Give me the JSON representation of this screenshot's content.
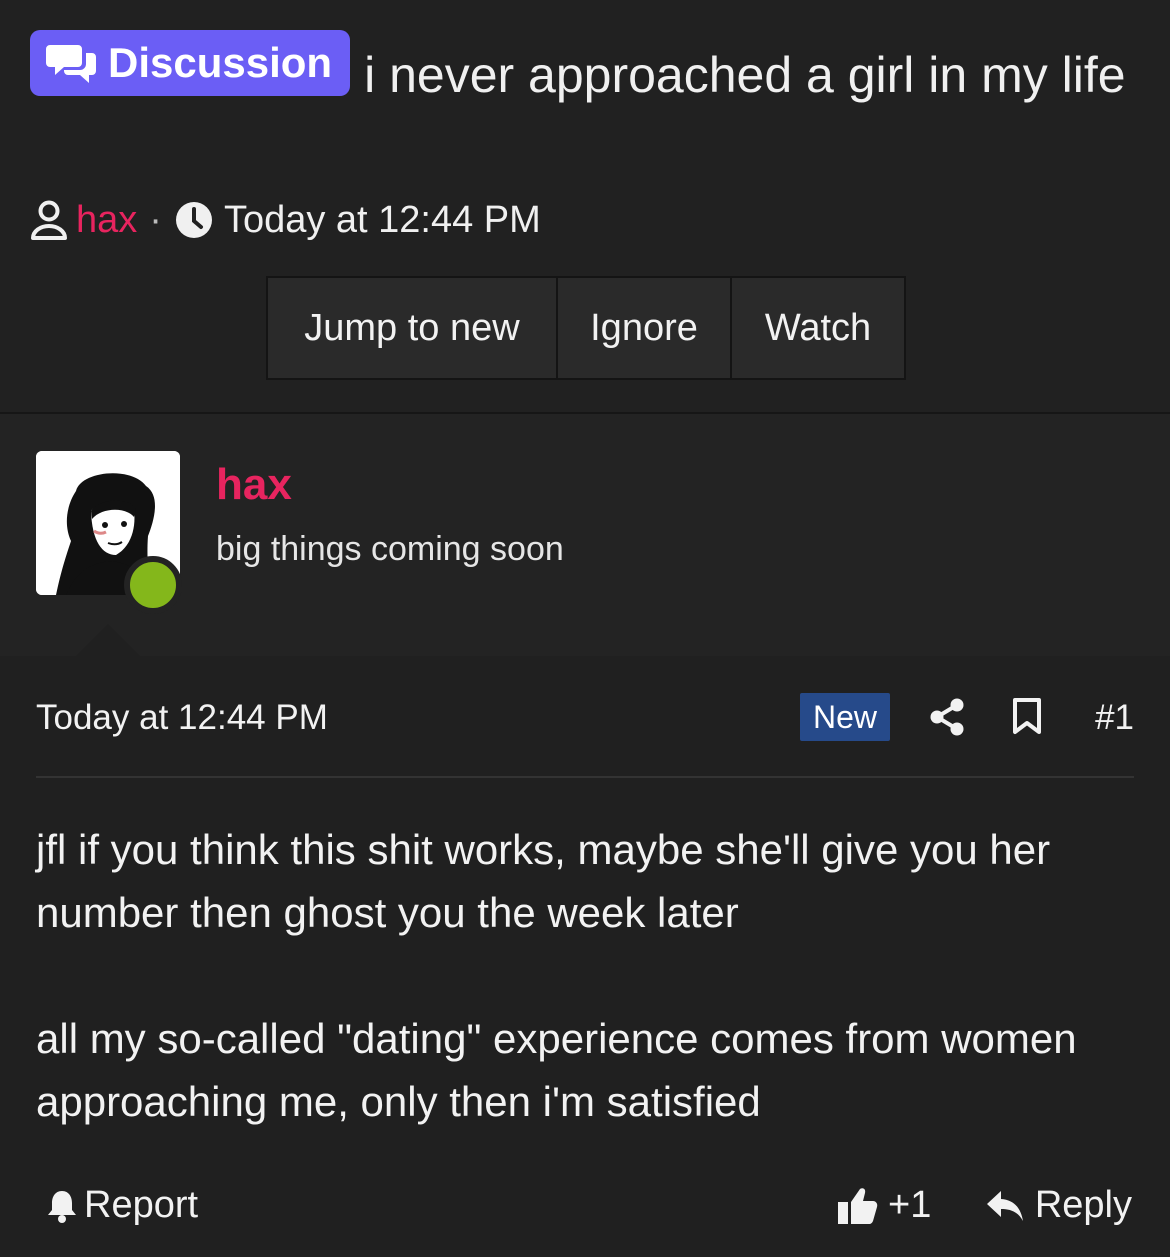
{
  "thread": {
    "prefix_label": "Discussion",
    "title": "i never approached a girl in my life",
    "author": "hax",
    "separator": "·",
    "date": "Today at 12:44 PM"
  },
  "actions": {
    "jump_to_new": "Jump to new",
    "ignore": "Ignore",
    "watch": "Watch"
  },
  "user": {
    "name": "hax",
    "title": "big things coming soon",
    "online": true
  },
  "post": {
    "date": "Today at 12:44 PM",
    "badge": "New",
    "number": "#1",
    "paragraphs": [
      "jfl if you think this shit works, maybe she'll give you her number then ghost you the week later",
      "all my so-called \"dating\" experience comes from women approaching me, only then i'm satisfied"
    ],
    "report_label": "Report",
    "reaction_count": "+1",
    "reply_label": "Reply"
  },
  "colors": {
    "background": "#202020",
    "prefix_pill": "#6b5ef5",
    "username": "#e8245f",
    "online": "#84b71b",
    "new_badge": "#264a8a"
  },
  "icons": {
    "prefix": "comments-icon",
    "author": "user-icon",
    "date": "clock-icon",
    "share": "share-icon",
    "bookmark": "bookmark-icon",
    "report": "bell-icon",
    "like": "thumbs-up-icon",
    "reply": "reply-icon"
  }
}
